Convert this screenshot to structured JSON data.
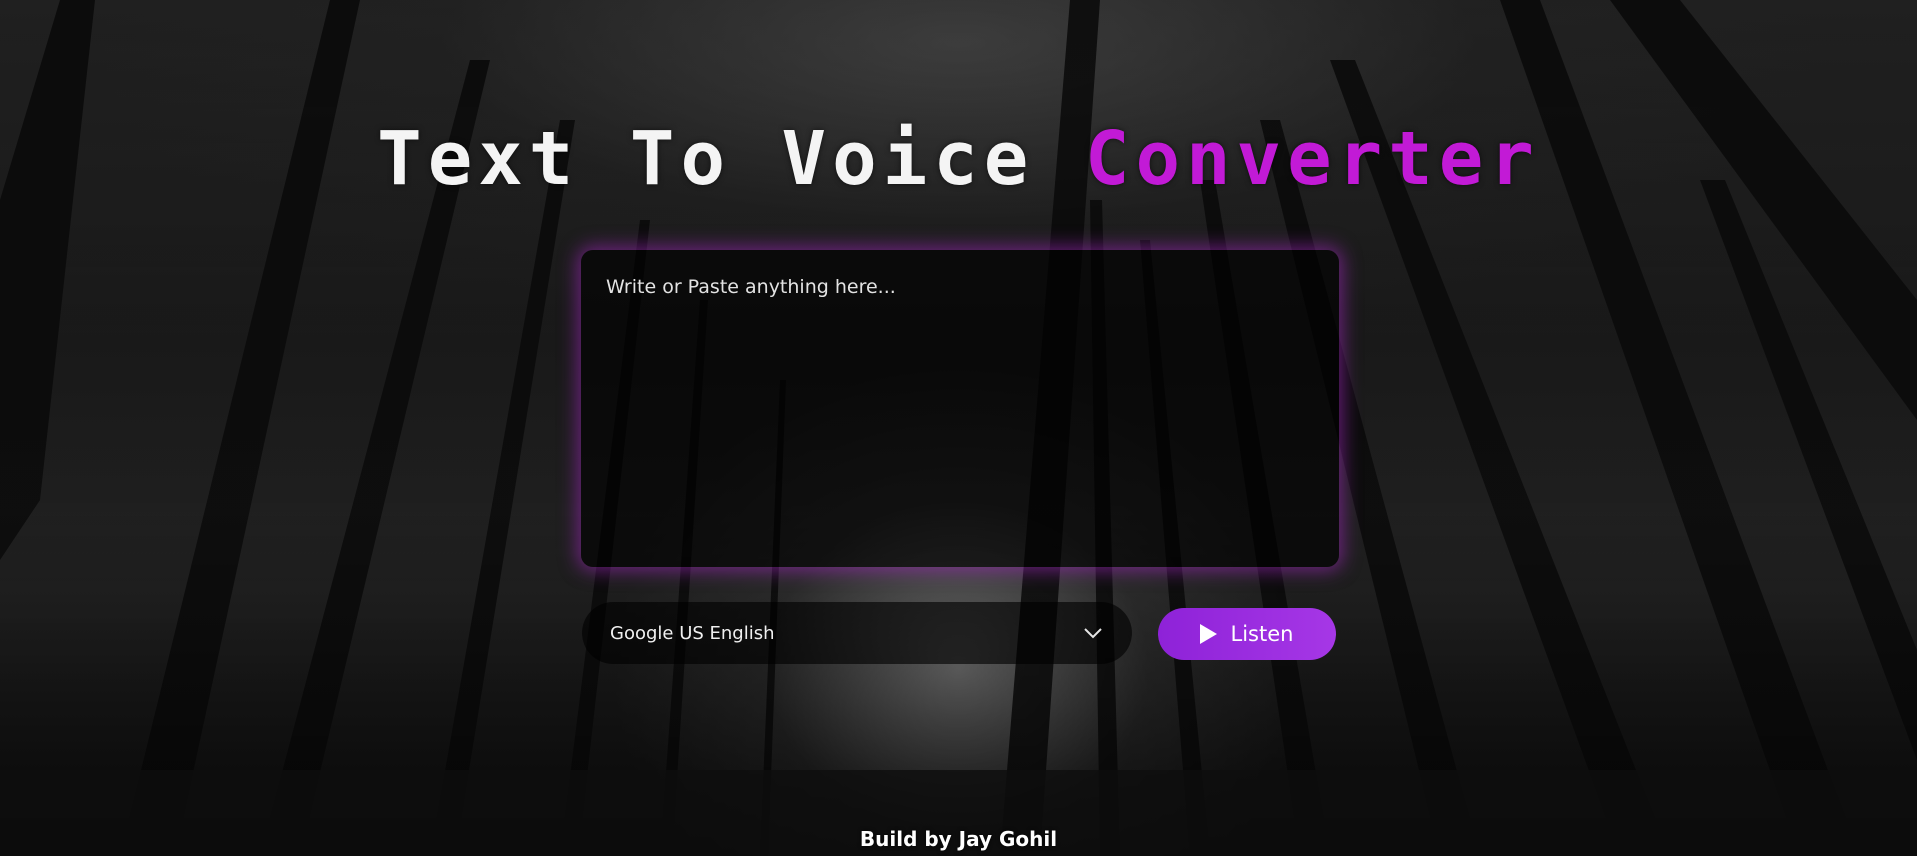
{
  "header": {
    "title_part1": "Text To Voice",
    "title_part2": "Converter"
  },
  "editor": {
    "placeholder": "Write or Paste anything here...",
    "value": ""
  },
  "voice_select": {
    "selected": "Google US English",
    "icon": "chevron-down-icon"
  },
  "listen_button": {
    "label": "Listen",
    "icon": "play-icon"
  },
  "footer": {
    "credit": "Build by Jay Gohil"
  },
  "colors": {
    "accent": "#c21ad6",
    "button": "#9a2be0",
    "glow": "#aa28c8"
  }
}
